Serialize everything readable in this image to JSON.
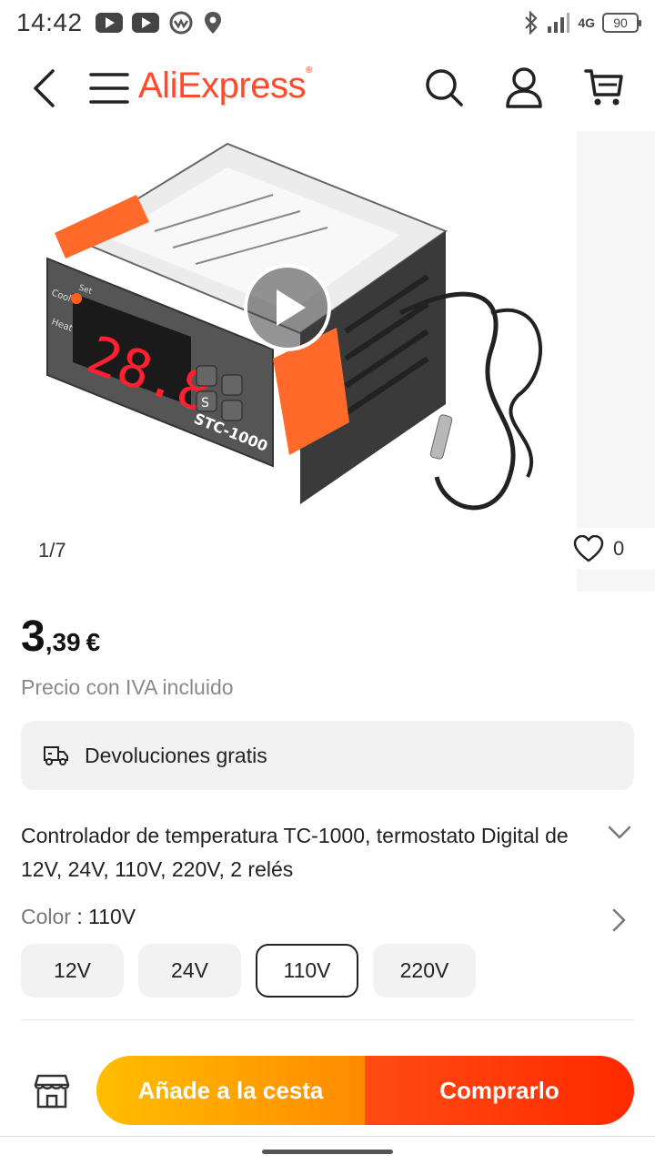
{
  "status_bar": {
    "time": "14:42",
    "network": "4G",
    "battery": "90"
  },
  "header": {
    "brand": "AliExpress",
    "brand_mark": "®"
  },
  "gallery": {
    "counter": "1/7",
    "wishlist_count": "0",
    "product_image_text": {
      "display": "28.8",
      "model": "STC-1000",
      "cool_label": "Cool",
      "heat_label": "Heat",
      "set_label": "Set",
      "s_key": "S"
    }
  },
  "price": {
    "integer": "3",
    "decimal": ",39",
    "currency": "€",
    "vat_note": "Precio con IVA incluido"
  },
  "returns": {
    "label": "Devoluciones gratis"
  },
  "product": {
    "title": "Controlador de temperatura TC-1000, termostato Digital de 12V, 24V, 110V, 220V, 2 relés"
  },
  "variant": {
    "label": "Color",
    "separator": " : ",
    "selected": "110V",
    "options": [
      "12V",
      "24V",
      "110V",
      "220V"
    ]
  },
  "actions": {
    "add_to_cart": "Añade a la cesta",
    "buy_now": "Comprarlo"
  },
  "colors": {
    "brand": "#ff4b2b",
    "cart_gradient_start": "#ffbe00",
    "buy_gradient": "#ff2a00"
  }
}
